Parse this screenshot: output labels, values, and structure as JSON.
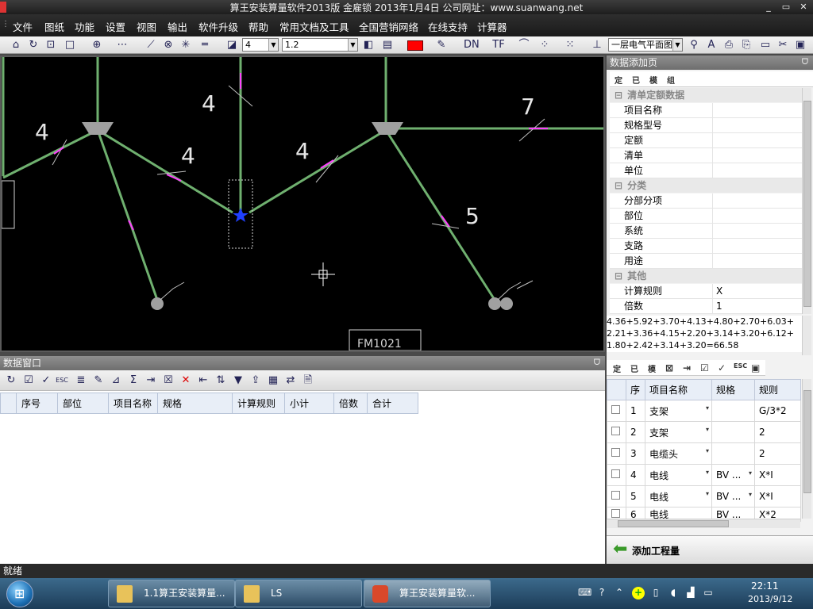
{
  "window": {
    "title": "算王安装算量软件2013版 金雇锁 2013年1月4日  公司网址：www.suanwang.net",
    "min": "_",
    "max": "▭",
    "close": "✕"
  },
  "menu": [
    "文件",
    "图纸",
    "功能",
    "设置",
    "视图",
    "输出",
    "软件升级",
    "帮助",
    "常用文档及工具",
    "全国营销网络",
    "在线支持",
    "计算器"
  ],
  "toolbar": {
    "line_width": "4",
    "scale": "1.2",
    "layer": "一层电气平面图"
  },
  "canvas": {
    "labels": [
      "4",
      "4",
      "4",
      "4",
      "7",
      "5"
    ],
    "bottom_text": "FM1021"
  },
  "data_window": {
    "title": "数据窗口",
    "pin": "ᗜ",
    "columns": [
      "序号",
      "部位",
      "项目名称",
      "规格",
      "计算规则",
      "小计",
      "倍数",
      "合计"
    ]
  },
  "right_panel": {
    "title": "数据添加页",
    "pin": "ᗜ",
    "mini_buttons": [
      "定",
      "已",
      "模",
      "组"
    ],
    "sections": [
      {
        "title": "清单定额数据",
        "fields": [
          {
            "k": "项目名称",
            "v": ""
          },
          {
            "k": "规格型号",
            "v": ""
          },
          {
            "k": "定额",
            "v": ""
          },
          {
            "k": "清单",
            "v": ""
          },
          {
            "k": "单位",
            "v": ""
          }
        ]
      },
      {
        "title": "分类",
        "fields": [
          {
            "k": "分部分项",
            "v": ""
          },
          {
            "k": "部位",
            "v": ""
          },
          {
            "k": "系统",
            "v": ""
          },
          {
            "k": "支路",
            "v": ""
          },
          {
            "k": "用途",
            "v": ""
          }
        ]
      },
      {
        "title": "其他",
        "fields": [
          {
            "k": "计算规则",
            "v": "X"
          },
          {
            "k": "倍数",
            "v": "1"
          }
        ]
      }
    ],
    "formula": "4.36+5.92+3.70+4.13+4.80+2.70+6.03+2.21+3.36+4.15+2.20+3.14+3.20+6.12+1.80+2.42+3.14+3.20=66.58",
    "table_buttons": [
      "定",
      "已",
      "模"
    ],
    "table_columns": [
      "序",
      "项目名称",
      "规格",
      "规则"
    ],
    "rows": [
      {
        "n": "1",
        "name": "支架",
        "spec": "",
        "rule": "G/3*2"
      },
      {
        "n": "2",
        "name": "支架",
        "spec": "",
        "rule": "2"
      },
      {
        "n": "3",
        "name": "电缆头",
        "spec": "",
        "rule": "2"
      },
      {
        "n": "4",
        "name": "电线",
        "spec": "BV ...",
        "rule": "X*I"
      },
      {
        "n": "5",
        "name": "电线",
        "spec": "BV ...",
        "rule": "X*I"
      },
      {
        "n": "6",
        "name": "电线",
        "spec": "BV ...",
        "rule": "X*2"
      }
    ],
    "add_button": "添加工程量"
  },
  "status": "就绪",
  "taskbar": {
    "tasks": [
      "1.1算王安装算量...",
      "LS",
      "算王安装算量软..."
    ],
    "time": "22:11",
    "date": "2013/9/12"
  },
  "colors": {
    "accent_red": "#ff0000",
    "wire_green": "#6fb06f",
    "canvas_bg": "#000000"
  }
}
